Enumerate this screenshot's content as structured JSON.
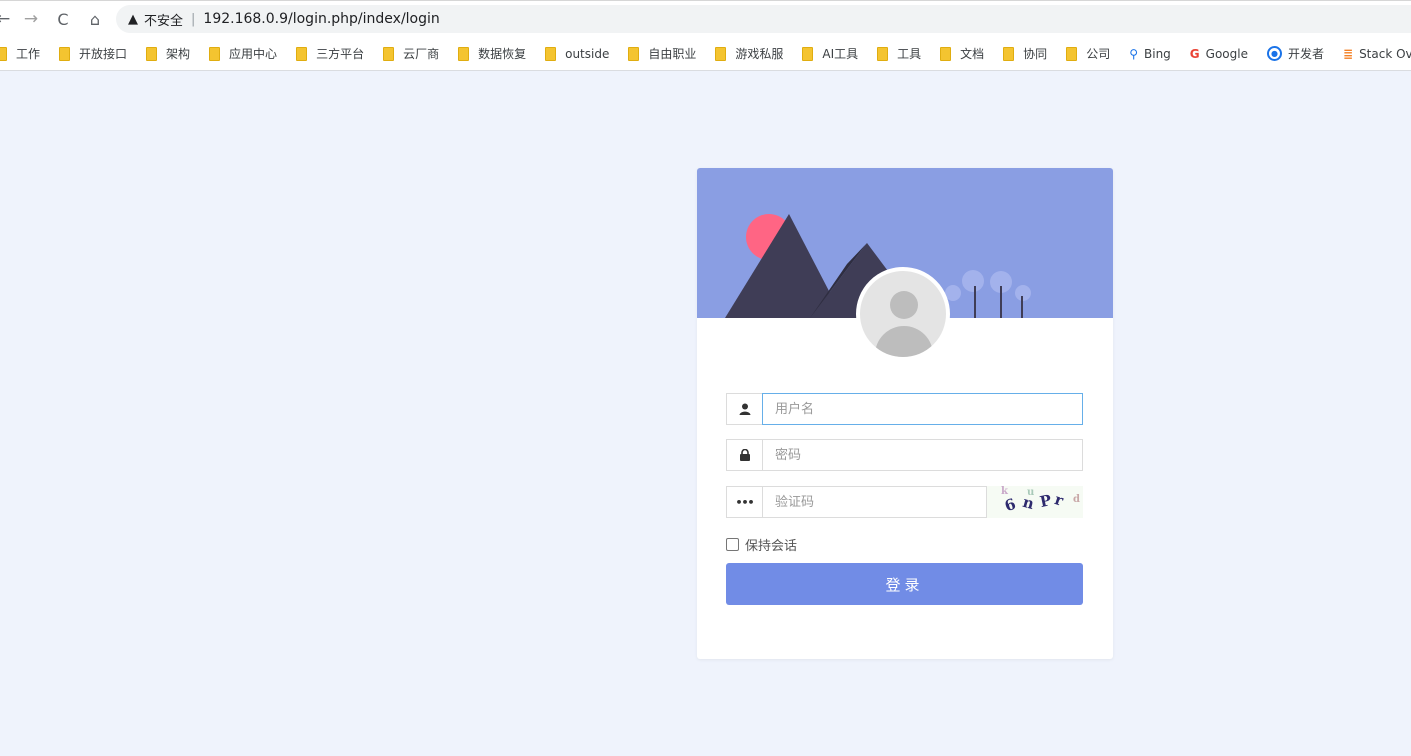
{
  "browser": {
    "security_label": "不安全",
    "separator": "|",
    "url": "192.168.0.9/login.php/index/login"
  },
  "bookmarks": [
    {
      "label": "工作",
      "icon": "folder-icon"
    },
    {
      "label": "开放接口",
      "icon": "folder-icon"
    },
    {
      "label": "架构",
      "icon": "folder-icon"
    },
    {
      "label": "应用中心",
      "icon": "folder-icon"
    },
    {
      "label": "三方平台",
      "icon": "folder-icon"
    },
    {
      "label": "云厂商",
      "icon": "folder-icon"
    },
    {
      "label": "数据恢复",
      "icon": "folder-icon"
    },
    {
      "label": "outside",
      "icon": "folder-icon"
    },
    {
      "label": "自由职业",
      "icon": "folder-icon"
    },
    {
      "label": "游戏私服",
      "icon": "folder-icon"
    },
    {
      "label": "AI工具",
      "icon": "folder-icon"
    },
    {
      "label": "工具",
      "icon": "folder-icon"
    },
    {
      "label": "文档",
      "icon": "folder-icon"
    },
    {
      "label": "协同",
      "icon": "folder-icon"
    },
    {
      "label": "公司",
      "icon": "folder-icon"
    },
    {
      "label": "Bing",
      "icon": "bing-icon"
    },
    {
      "label": "Google",
      "icon": "google-icon"
    },
    {
      "label": "开发者",
      "icon": "developer-icon"
    },
    {
      "label": "Stack Overflo",
      "icon": "stackoverflow-icon"
    }
  ],
  "login": {
    "username_placeholder": "用户名",
    "password_placeholder": "密码",
    "captcha_placeholder": "验证码",
    "captcha_text": "6nPr",
    "remember_label": "保持会话",
    "submit_label": "登录"
  },
  "colors": {
    "page_bg": "#eff3fc",
    "banner_bg": "#8a9ee3",
    "button_bg": "#718ce6",
    "sun": "#ff6584",
    "mountain": "#3f3d56"
  }
}
